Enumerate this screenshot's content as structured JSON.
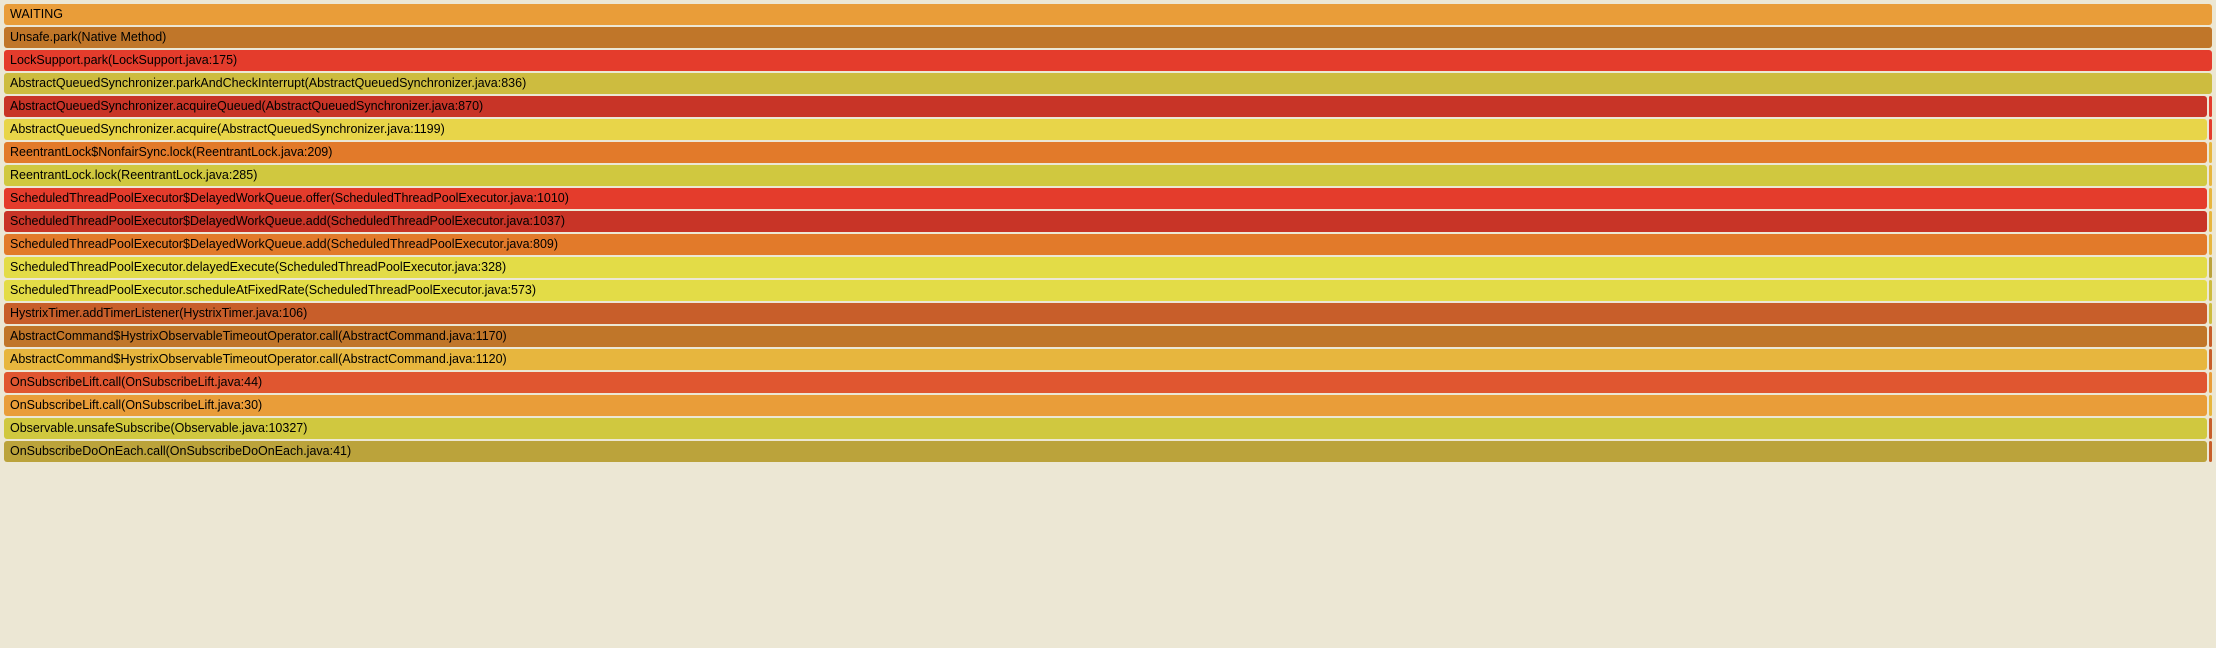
{
  "rows": [
    {
      "label": "WAITING",
      "color": "c-orange",
      "slivers": []
    },
    {
      "label": "Unsafe.park(Native Method)",
      "color": "c-brown",
      "slivers": []
    },
    {
      "label": "LockSupport.park(LockSupport.java:175)",
      "color": "c-red",
      "slivers": []
    },
    {
      "label": "AbstractQueuedSynchronizer.parkAndCheckInterrupt(AbstractQueuedSynchronizer.java:836)",
      "color": "c-olive",
      "slivers": []
    },
    {
      "label": "AbstractQueuedSynchronizer.acquireQueued(AbstractQueuedSynchronizer.java:870)",
      "color": "c-darkred",
      "slivers": [
        "c-red"
      ]
    },
    {
      "label": "AbstractQueuedSynchronizer.acquire(AbstractQueuedSynchronizer.java:1199)",
      "color": "c-yellow",
      "slivers": [
        "c-red"
      ]
    },
    {
      "label": "ReentrantLock$NonfairSync.lock(ReentrantLock.java:209)",
      "color": "c-dorange",
      "slivers": [
        "c-gold"
      ]
    },
    {
      "label": "ReentrantLock.lock(ReentrantLock.java:285)",
      "color": "c-mustard",
      "slivers": [
        "c-gold"
      ]
    },
    {
      "label": "ScheduledThreadPoolExecutor$DelayedWorkQueue.offer(ScheduledThreadPoolExecutor.java:1010)",
      "color": "c-red",
      "slivers": [
        "c-gold"
      ]
    },
    {
      "label": "ScheduledThreadPoolExecutor$DelayedWorkQueue.add(ScheduledThreadPoolExecutor.java:1037)",
      "color": "c-darkred",
      "slivers": [
        "c-gold"
      ]
    },
    {
      "label": "ScheduledThreadPoolExecutor$DelayedWorkQueue.add(ScheduledThreadPoolExecutor.java:809)",
      "color": "c-dorange",
      "slivers": [
        "c-gold"
      ]
    },
    {
      "label": "ScheduledThreadPoolExecutor.delayedExecute(ScheduledThreadPoolExecutor.java:328)",
      "color": "c-lemon",
      "slivers": [
        "c-brass"
      ]
    },
    {
      "label": "ScheduledThreadPoolExecutor.scheduleAtFixedRate(ScheduledThreadPoolExecutor.java:573)",
      "color": "c-lemon",
      "slivers": [
        "c-olive"
      ]
    },
    {
      "label": "HystrixTimer.addTimerListener(HystrixTimer.java:106)",
      "color": "c-rust",
      "slivers": [
        "c-olive"
      ]
    },
    {
      "label": "AbstractCommand$HystrixObservableTimeoutOperator.call(AbstractCommand.java:1170)",
      "color": "c-brown",
      "slivers": [
        "c-rust"
      ]
    },
    {
      "label": "AbstractCommand$HystrixObservableTimeoutOperator.call(AbstractCommand.java:1120)",
      "color": "c-gold",
      "slivers": [
        "c-rust"
      ]
    },
    {
      "label": "OnSubscribeLift.call(OnSubscribeLift.java:44)",
      "color": "c-ored",
      "slivers": [
        "c-orange"
      ]
    },
    {
      "label": "OnSubscribeLift.call(OnSubscribeLift.java:30)",
      "color": "c-orange",
      "slivers": [
        "c-gold"
      ]
    },
    {
      "label": "Observable.unsafeSubscribe(Observable.java:10327)",
      "color": "c-mustard",
      "slivers": [
        "c-rust"
      ]
    },
    {
      "label": "OnSubscribeDoOnEach.call(OnSubscribeDoOnEach.java:41)",
      "color": "c-brass",
      "slivers": [
        "c-rust"
      ]
    }
  ]
}
